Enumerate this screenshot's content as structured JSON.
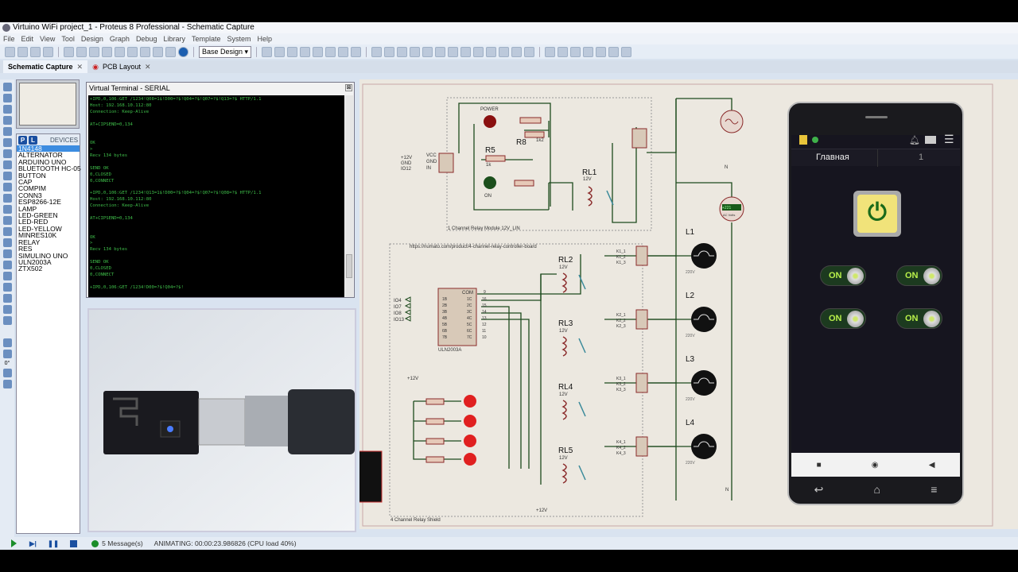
{
  "window": {
    "title": "Virtuino WiFi project_1 - Proteus 8 Professional - Schematic Capture"
  },
  "menu": [
    "File",
    "Edit",
    "View",
    "Tool",
    "Design",
    "Graph",
    "Debug",
    "Library",
    "Template",
    "System",
    "Help"
  ],
  "toolbar": {
    "design_select": "Base Design"
  },
  "tabs": [
    {
      "label": "Schematic Capture",
      "close": "✕"
    },
    {
      "label": "PCB Layout",
      "close": "✕"
    }
  ],
  "devices": {
    "p_label": "P",
    "l_label": "L",
    "header": "DEVICES",
    "selected": "1N4148",
    "items": [
      "1N4148",
      "ALTERNATOR",
      "ARDUINO UNO",
      "BLUETOOTH HC-05",
      "BUTTON",
      "CAP",
      "COMPIM",
      "CONN3",
      "ESP8266-12E",
      "LAMP",
      "LED-GREEN",
      "LED-RED",
      "LED-YELLOW",
      "MINRES10K",
      "RELAY",
      "RES",
      "SIMULINO UNO",
      "ULN2003A",
      "ZTX502"
    ]
  },
  "left_panel": {
    "rotation": "0°"
  },
  "terminal": {
    "title": "Virtual Terminal - SERIAL",
    "close": "⊠",
    "lines": [
      "+IPD,0,106:GET /1234!Q08=1$!D00=?$!Q04=?$!Q07=?$!Q13=?$ HTTP/1.1",
      "Host: 192.168.10.112:80",
      "Connection: Keep-Alive",
      "",
      "AT+CIPSEND=0,134",
      "",
      "",
      "OK",
      ">",
      "Recv 134 bytes",
      "",
      "SEND OK",
      "0,CLOSED",
      "0,CONNECT",
      "",
      "+IPD,0,106:GET /1234!Q13=1$!D00=?$!Q04=?$!Q07=?$!Q08=?$ HTTP/1.1",
      "Host: 192.168.10.112:80",
      "Connection: Keep-Alive",
      "",
      "AT+CIPSEND=0,134",
      "",
      "",
      "OK",
      ">",
      "Recv 134 bytes",
      "",
      "SEND OK",
      "0,CLOSED",
      "0,CONNECT",
      "",
      "+IPD,0,106:GET /1234!D00=?$!Q04=?$!"
    ]
  },
  "schematic": {
    "relay1": {
      "frame_label": "1 Channel Relay Module 12V_LIN",
      "power": "POWER",
      "on": "ON",
      "r5": "R5",
      "r5_value": "1k",
      "r8": "R8",
      "r8_value": "1k2",
      "rl1": "RL1",
      "rl1_v": "12V",
      "vcc": "VCC",
      "gnd": "GND",
      "in": "IN",
      "p12": "+12V",
      "pgnd": "GND",
      "io12": "IO12"
    },
    "relay4": {
      "frame_label": "4 Channel Relay Shield",
      "url": "https://numato.com/product/4-channel-relay-controller-board",
      "uln": "ULN2003A",
      "com": "COM",
      "inputs": [
        "IO4",
        "IO7",
        "IO8",
        "IO13"
      ],
      "pins_in": [
        "1B",
        "2B",
        "3B",
        "4B",
        "5B",
        "6B",
        "7B"
      ],
      "pins_out": [
        "1C",
        "2C",
        "3C",
        "4C",
        "5C",
        "6C",
        "7C"
      ],
      "pin_nums_out": [
        "16",
        "15",
        "14",
        "13",
        "12",
        "11",
        "10"
      ],
      "com_pin": "9",
      "relays": [
        "RL2",
        "RL3",
        "RL4",
        "RL5"
      ],
      "relay_v": "12V",
      "plus12": "+12V",
      "minus12": "+12V",
      "k_labels": [
        [
          "K1_1",
          "K1_2",
          "K1_3"
        ],
        [
          "K2_1",
          "K2_2",
          "K2_3"
        ],
        [
          "K3_1",
          "K3_2",
          "K3_3"
        ],
        [
          "K4_1",
          "K4_2",
          "K4_3"
        ]
      ]
    },
    "lamps": [
      {
        "name": "L1",
        "v": "220V"
      },
      {
        "name": "L2",
        "v": "220V"
      },
      {
        "name": "L3",
        "v": "220V"
      },
      {
        "name": "L4",
        "v": "220V"
      }
    ],
    "voltmeter": {
      "value": "+221",
      "unit": "AC Volts"
    },
    "neutral": "N"
  },
  "phone": {
    "tab_label": "Главная",
    "page_number": "1",
    "switches": [
      {
        "label": "ON",
        "state": true
      },
      {
        "label": "ON",
        "state": true
      },
      {
        "label": "ON",
        "state": true
      },
      {
        "label": "ON",
        "state": true
      }
    ],
    "power_button_state": "on",
    "colors": {
      "accent": "#b8f04a",
      "power_face": "#f1e37a"
    }
  },
  "status": {
    "messages": "5 Message(s)",
    "animating": "ANIMATING: 00:00:23.986826 (CPU load 40%)"
  }
}
